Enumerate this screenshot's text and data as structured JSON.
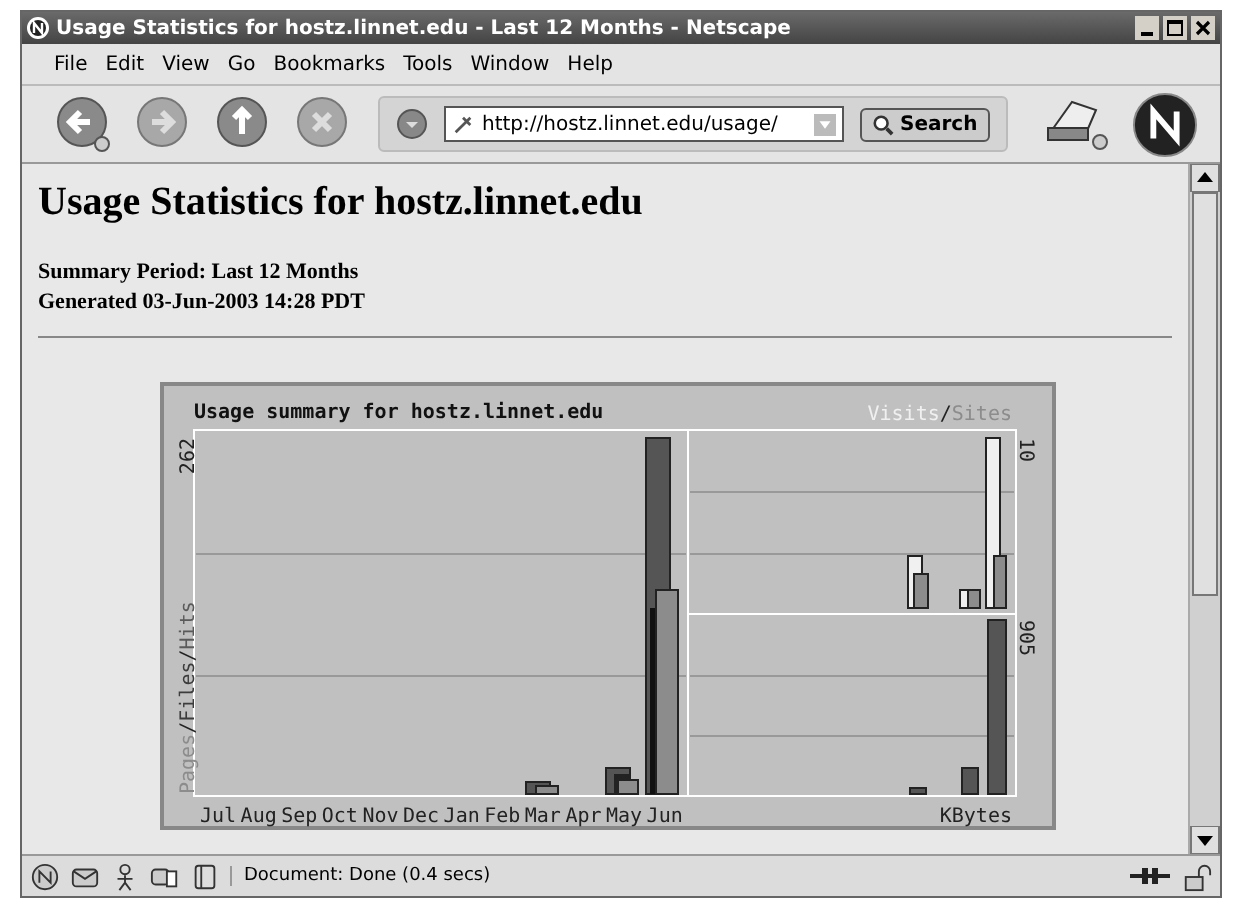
{
  "window": {
    "title": "Usage Statistics for hostz.linnet.edu - Last 12 Months - Netscape"
  },
  "menu": [
    "File",
    "Edit",
    "View",
    "Go",
    "Bookmarks",
    "Tools",
    "Window",
    "Help"
  ],
  "toolbar": {
    "url": "http://hostz.linnet.edu/usage/",
    "search_label": "Search"
  },
  "page": {
    "heading": "Usage Statistics for hostz.linnet.edu",
    "lines": [
      "Summary Period: Last 12 Months",
      "Generated 03-Jun-2003 14:28 PDT"
    ]
  },
  "chart": {
    "title": "Usage summary for hostz.linnet.edu",
    "left_max": "262",
    "top_right_max": "10",
    "bottom_right_max": "905",
    "bottom_right_label": "KBytes",
    "separator": "/",
    "left_legend": [
      {
        "label": "Pages",
        "color": "#8c8c8c"
      },
      {
        "label": "Files",
        "color": "#3c3c3c"
      },
      {
        "label": "Hits",
        "color": "#5a5a5a"
      }
    ],
    "right_legend": [
      {
        "label": "Visits",
        "color": "#f0f0f0"
      },
      {
        "label": "Sites",
        "color": "#8c8c8c"
      }
    ],
    "months": [
      "Jul",
      "Aug",
      "Sep",
      "Oct",
      "Nov",
      "Dec",
      "Jan",
      "Feb",
      "Mar",
      "Apr",
      "May",
      "Jun"
    ]
  },
  "status_bar": {
    "text": "Document: Done (0.4 secs)"
  }
}
